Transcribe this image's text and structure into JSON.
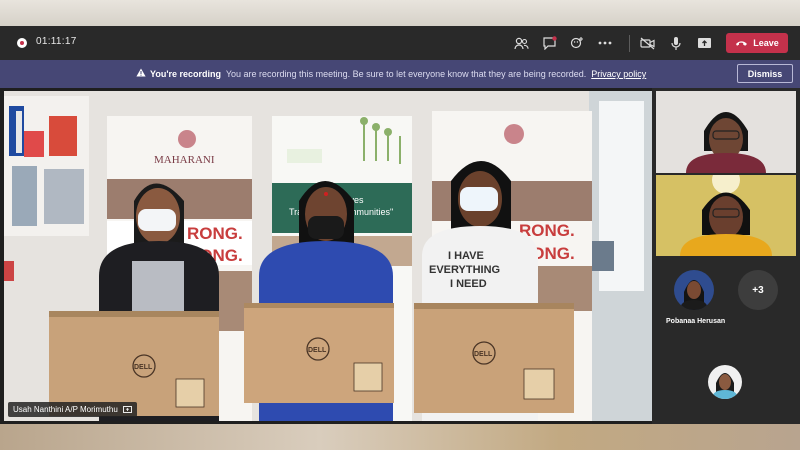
{
  "call_bar": {
    "timer": "01:11:17",
    "leave_label": "Leave",
    "icons": [
      "record-icon",
      "participants-icon",
      "chat-icon",
      "reactions-icon",
      "more-icon",
      "camera-off-icon",
      "mic-icon",
      "share-icon",
      "phone-icon"
    ],
    "leave_color": "#c4314b",
    "bar_color": "#292929"
  },
  "recording_banner": {
    "title": "You're recording",
    "message": "You are recording this meeting. Be sure to let everyone know that they are being recorded.",
    "link": "Privacy policy",
    "dismiss_label": "Dismiss",
    "banner_color": "#464775"
  },
  "main_video": {
    "participant_name": "Usah Nanthini A/P Morimuthu",
    "scene": {
      "tshirt_lines": [
        "I HAVE",
        "EVERYTHING",
        "I NEED"
      ],
      "box_brand": "DELL",
      "banner_brand": "MAHARANI",
      "banner_words": [
        "RONG.",
        "RONG."
      ],
      "tagline": "ng Lives",
      "tagline2": "Tra",
      "tagline3": "ommunities\""
    }
  },
  "side_panel": {
    "named_participant": "Pobanaa Herusan",
    "overflow_count": "+3"
  }
}
